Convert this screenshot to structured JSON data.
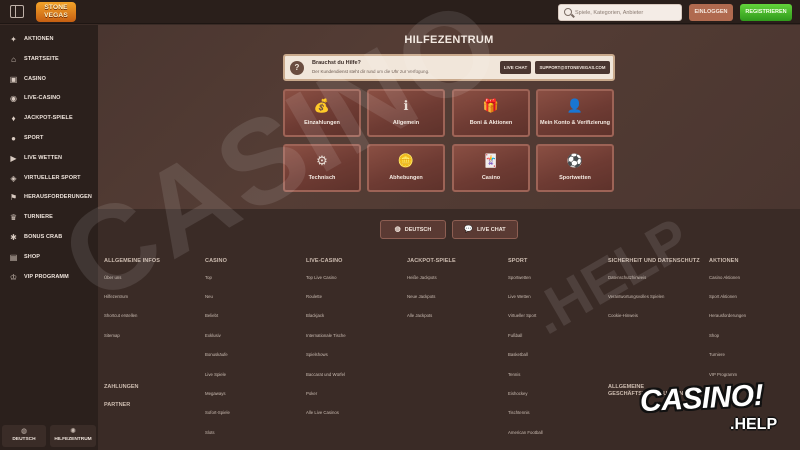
{
  "topbar": {
    "logo_line1": "STONE",
    "logo_line2": "VEGAS",
    "search_placeholder": "Spiele, Kategorien, Anbieter",
    "login_label": "EINLOGGEN",
    "register_label": "REGISTRIEREN"
  },
  "sidebar": {
    "items": [
      {
        "label": "AKTIONEN",
        "icon": "gift-icon"
      },
      {
        "label": "STARTSEITE",
        "icon": "home-icon"
      },
      {
        "label": "CASINO",
        "icon": "slot-icon"
      },
      {
        "label": "LIVE-CASINO",
        "icon": "live-icon"
      },
      {
        "label": "JACKPOT-SPIELE",
        "icon": "jackpot-icon"
      },
      {
        "label": "SPORT",
        "icon": "sport-icon"
      },
      {
        "label": "LIVE WETTEN",
        "icon": "live-bet-icon"
      },
      {
        "label": "VIRTUELLER SPORT",
        "icon": "virtual-sport-icon"
      },
      {
        "label": "HERAUSFORDERUNGEN",
        "icon": "challenge-icon"
      },
      {
        "label": "TURNIERE",
        "icon": "trophy-icon"
      },
      {
        "label": "BONUS CRAB",
        "icon": "crab-icon"
      },
      {
        "label": "SHOP",
        "icon": "shop-icon"
      },
      {
        "label": "VIP PROGRAMM",
        "icon": "vip-icon"
      }
    ],
    "bottom": {
      "language_label": "DEUTSCH",
      "help_label": "HILFEZENTRUM"
    }
  },
  "main": {
    "title": "HILFEZENTRUM",
    "banner": {
      "title": "Brauchst du Hilfe?",
      "subtitle": "Der Kundendienst steht dir rund um die Uhr zur Verfügung.",
      "chat_label": "LIVE CHAT",
      "support_label": "SUPPORT@STONEVEGAS.COM"
    },
    "tiles": [
      {
        "label": "Einzahlungen",
        "icon": "money-bag-icon"
      },
      {
        "label": "Allgemein",
        "icon": "info-icon"
      },
      {
        "label": "Boni & Aktionen",
        "icon": "gift-box-icon"
      },
      {
        "label": "Mein Konto & Verifizierung",
        "icon": "account-icon"
      },
      {
        "label": "Technisch",
        "icon": "cog-icon"
      },
      {
        "label": "Abhebungen",
        "icon": "coins-icon"
      },
      {
        "label": "Casino",
        "icon": "cards-icon"
      },
      {
        "label": "Sportwetten",
        "icon": "football-icon"
      }
    ]
  },
  "footer": {
    "language_button": "DEUTSCH",
    "chat_button": "LIVE CHAT",
    "columns": [
      {
        "title": "ALLGEMEINE INFOS",
        "items": [
          "Über uns",
          "Hilfezentrum",
          "Shortcut erstellen",
          "Sitemap"
        ]
      },
      {
        "title": "CASINO",
        "items": [
          "Top",
          "Neu",
          "Beliebt",
          "Exklusiv",
          "Bonuskäufe",
          "Live Spiele",
          "Megaways",
          "Sofort-Spiele",
          "Slots"
        ]
      },
      {
        "title": "LIVE-CASINO",
        "items": [
          "Top Live Casino",
          "Roulette",
          "Blackjack",
          "Internationale Tische",
          "Spielshows",
          "Baccarat und Würfel",
          "Poker",
          "Alle Live Casinos"
        ]
      },
      {
        "title": "JACKPOT-SPIELE",
        "items": [
          "Heiße Jackpots",
          "Neue Jackpots",
          "Alle Jackpots"
        ]
      },
      {
        "title": "SPORT",
        "items": [
          "Sportwetten",
          "Live Wetten",
          "Virtueller Sport",
          "Fußball",
          "Basketball",
          "Tennis",
          "Eishockey",
          "Tischtennis",
          "American Football"
        ]
      },
      {
        "title": "SICHERHEIT UND DATENSCHUTZ",
        "items": [
          "Datenschutzhinweis",
          "Verantwortungsvolles Spielen",
          "Cookie-Hinweis"
        ]
      },
      {
        "title": "AKTIONEN",
        "items": [
          "Casino Aktionen",
          "Sport Aktionen",
          "Herausforderungen",
          "Shop",
          "Turniere",
          "VIP Programm"
        ]
      }
    ],
    "extra_titles": {
      "zahlungen": "ZAHLUNGEN",
      "partner": "PARTNER",
      "agb": "ALLGEMEINE GESCHÄFTSBEDINGUNGEN"
    }
  },
  "watermark": {
    "big": "CASINO",
    "help": ".HELP",
    "badge_line1": "CASINO!",
    "badge_line2": ".HELP"
  }
}
